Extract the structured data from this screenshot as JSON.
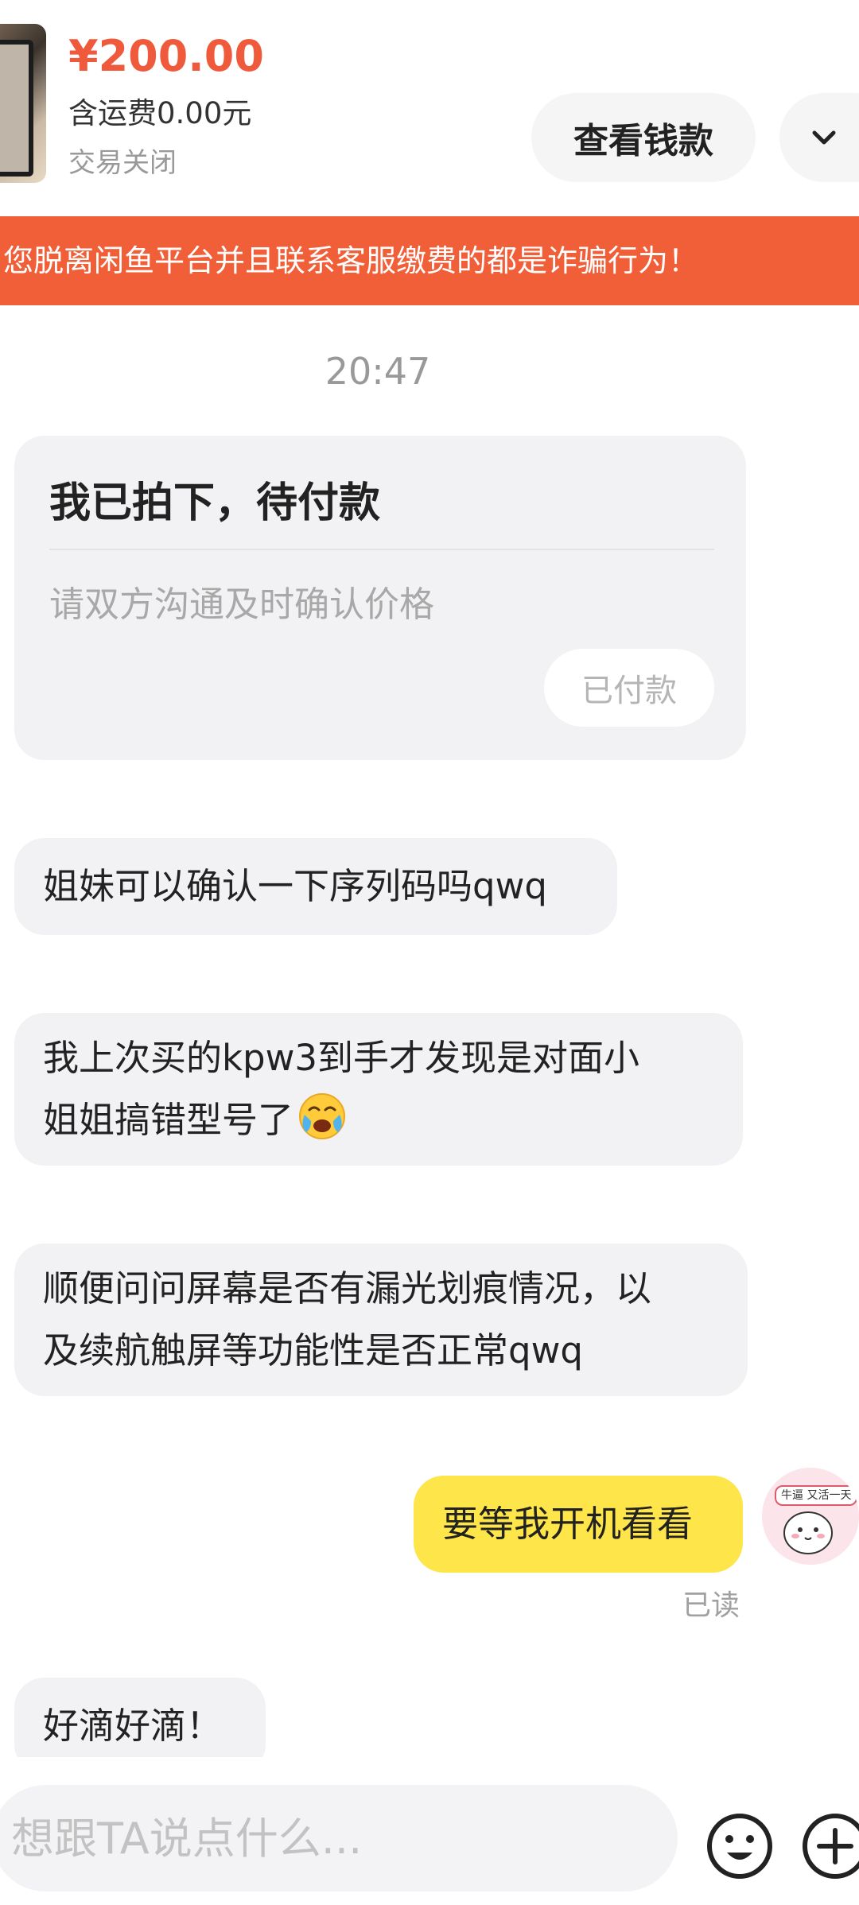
{
  "order": {
    "price": "¥200.00",
    "shipping": "含运费0.00元",
    "status": "交易关闭",
    "view_payment_label": "查看钱款"
  },
  "warning": {
    "text": "您脱离闲鱼平台并且联系客服缴费的都是诈骗行为！"
  },
  "chat": {
    "timestamp": "20:47",
    "order_card": {
      "title": "我已拍下，待付款",
      "note": "请双方沟通及时确认价格",
      "paid_label": "已付款"
    },
    "messages": [
      {
        "from": "other",
        "text": "姐妹可以确认一下序列码吗qwq"
      },
      {
        "from": "other",
        "lines": [
          "我上次买的kpw3到手才发现是对面小",
          "姐姐搞错型号了"
        ],
        "emoji": "crying-face"
      },
      {
        "from": "other",
        "lines": [
          "顺便问问屏幕是否有漏光划痕情况，以",
          "及续航触屏等功能性是否正常qwq"
        ]
      },
      {
        "from": "me",
        "text": "要等我开机看看",
        "status": "已读"
      },
      {
        "from": "other",
        "text": "好滴好滴！"
      }
    ],
    "avatar_sticker_text": "牛逼 又活一天"
  },
  "input": {
    "placeholder": "想跟TA说点什么..."
  },
  "icons": {
    "expand": "chevron-down-icon",
    "emoji": "smiley-icon",
    "plus": "plus-circle-icon"
  },
  "colors": {
    "price": "#f05a3c",
    "banner": "#f05f38",
    "my_bubble": "#fde54a",
    "other_bubble": "#f2f2f4"
  }
}
